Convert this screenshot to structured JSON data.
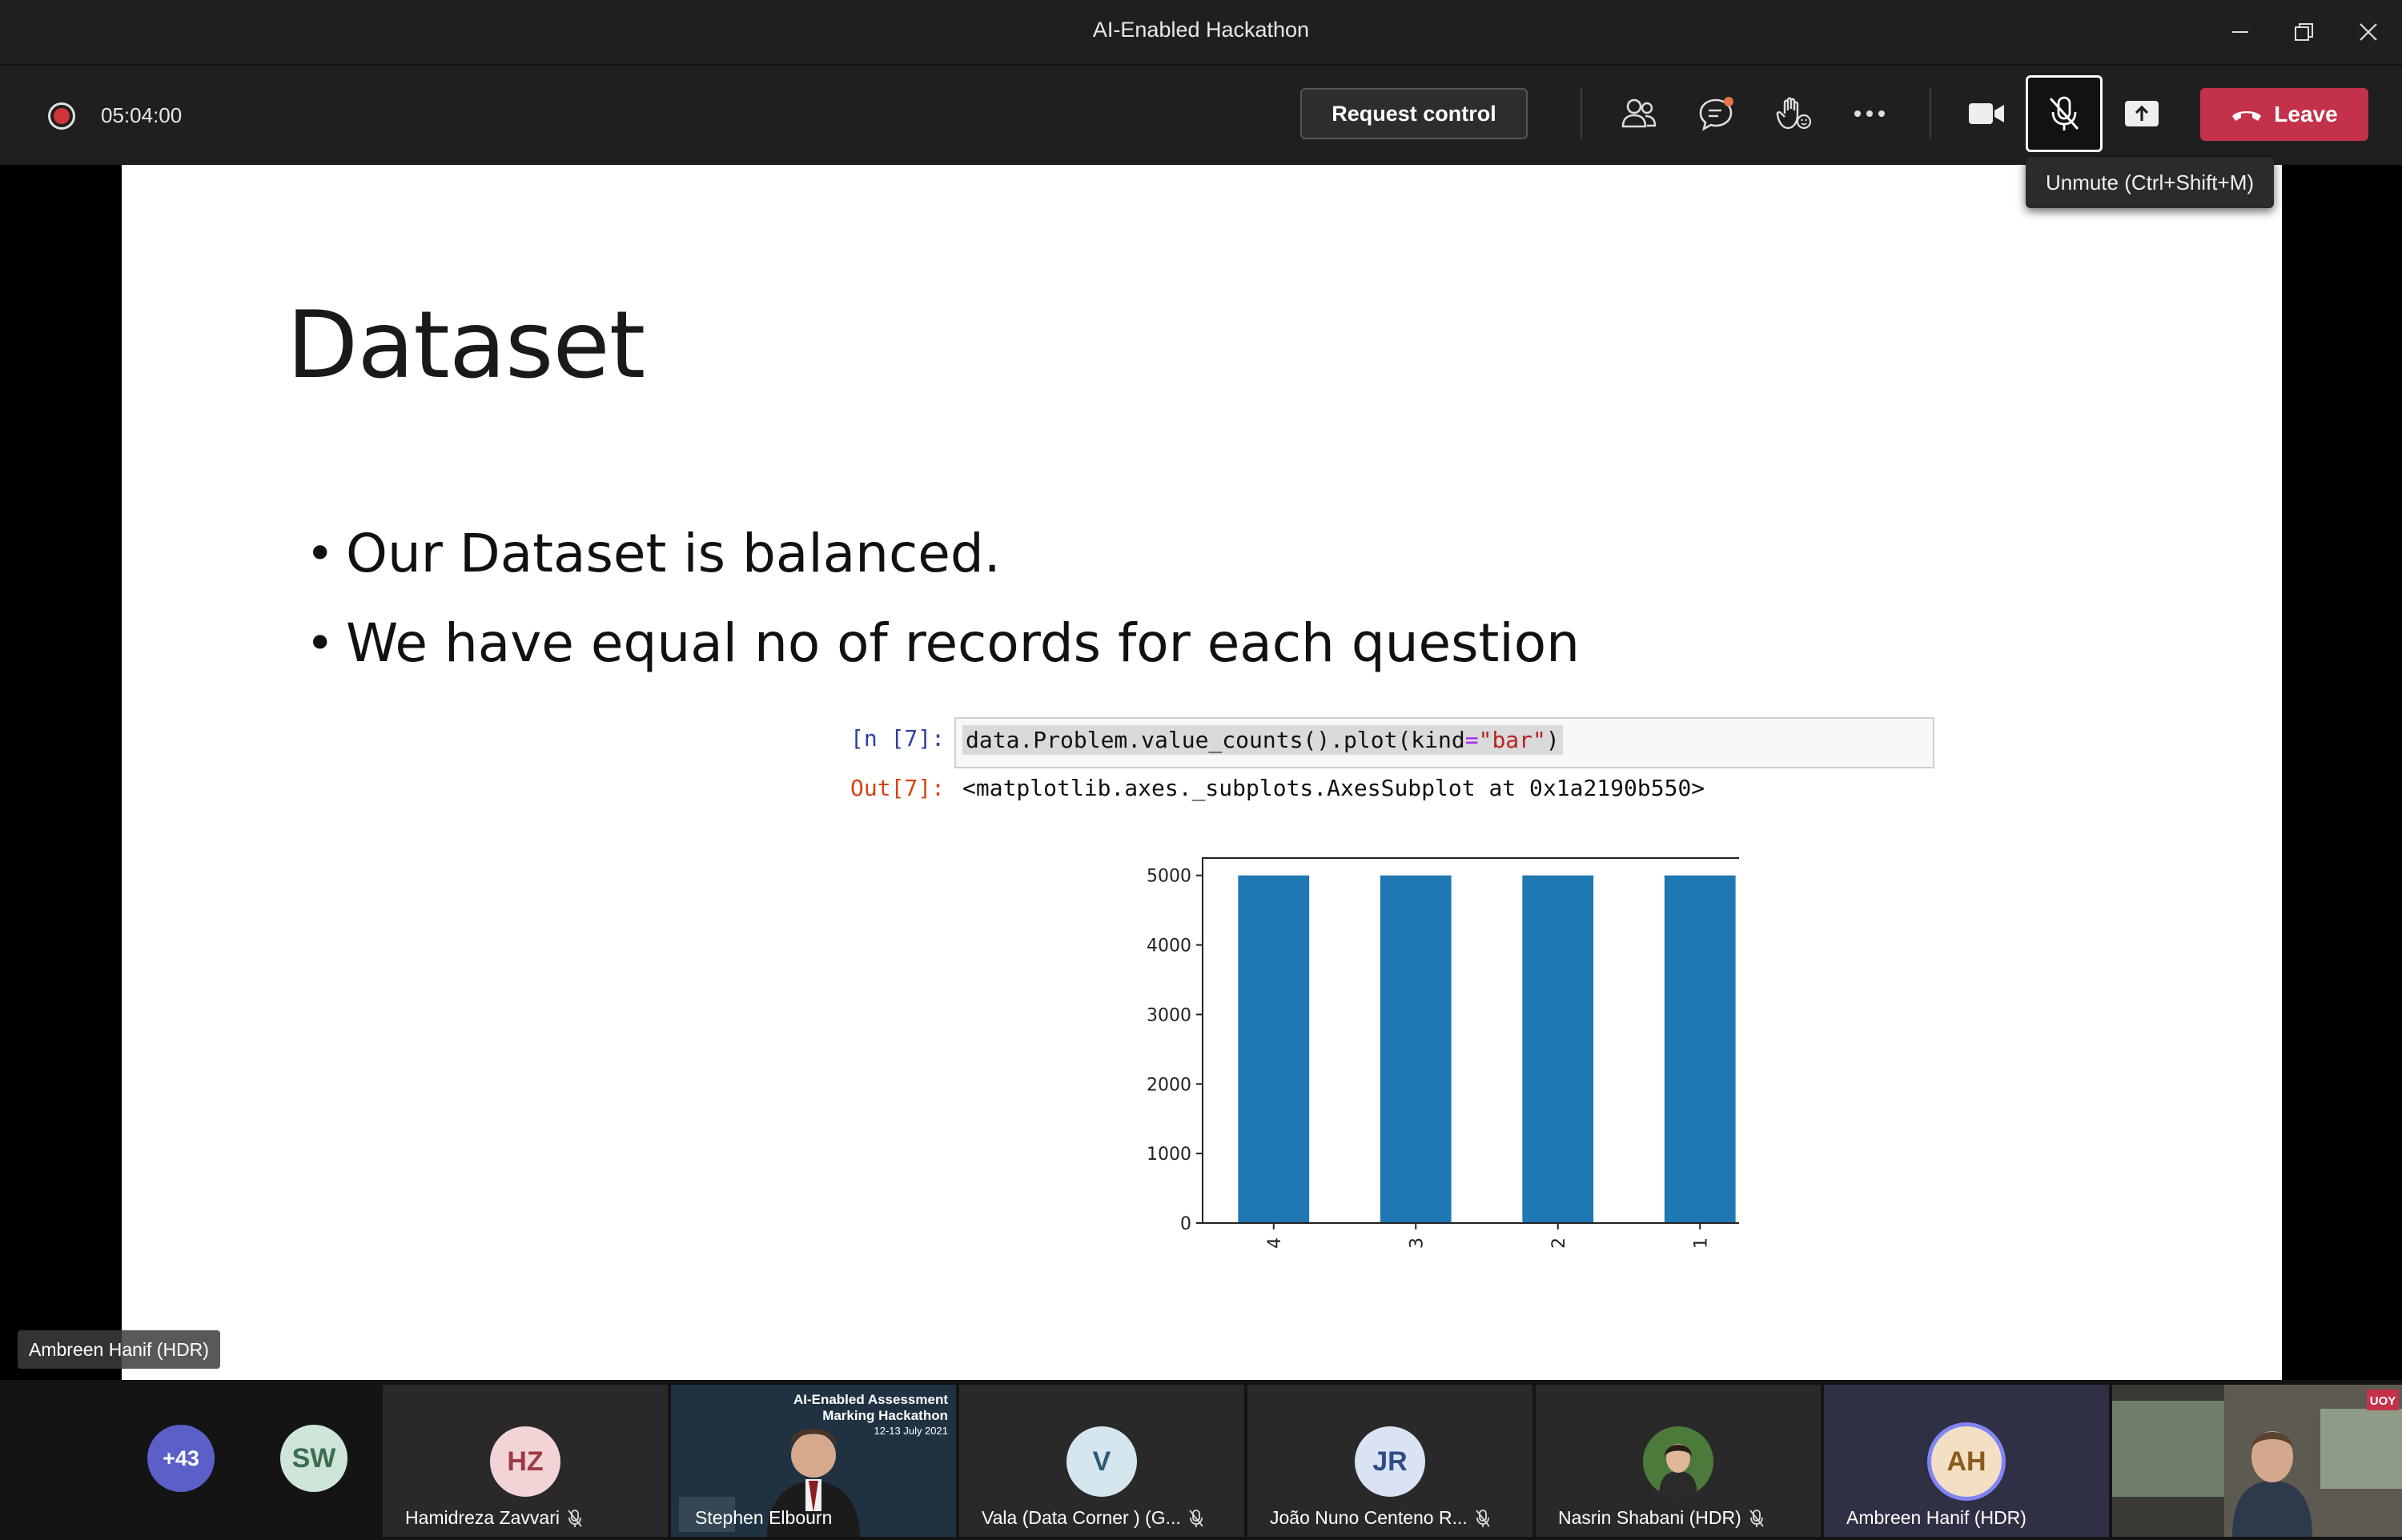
{
  "window": {
    "title": "AI-Enabled Hackathon"
  },
  "toolbar": {
    "timer": "05:04:00",
    "request_control": "Request control",
    "leave": "Leave",
    "tooltip": "Unmute (Ctrl+Shift+M)"
  },
  "slide": {
    "title": "Dataset",
    "bullets": [
      "Our Dataset is balanced.",
      "We have equal no of records for each question"
    ],
    "code": {
      "in_prompt": "[n [7]:",
      "out_prompt": "Out[7]:",
      "code_prefix": "data.Problem.value_counts().plot(kind",
      "code_op": "=",
      "code_str": "\"bar\"",
      "code_suffix": ")",
      "output": "<matplotlib.axes._subplots.AxesSubplot at 0x1a2190b550>"
    }
  },
  "chart_data": {
    "type": "bar",
    "categories": [
      "4",
      "3",
      "2",
      "1"
    ],
    "values": [
      5000,
      5000,
      5000,
      5000
    ],
    "ylim": [
      0,
      5250
    ],
    "yticks": [
      0,
      1000,
      2000,
      3000,
      4000,
      5000
    ],
    "color": "#1f77b4",
    "title": "",
    "xlabel": "",
    "ylabel": "",
    "grid": false,
    "xtick_rotation": 90
  },
  "speaker": {
    "name": "Ambreen Hanif (HDR)"
  },
  "participants": {
    "overflow": "+43",
    "sw": "SW",
    "tiles": [
      {
        "initials": "HZ",
        "name": "Hamidreza Zavvari",
        "bg": "#f2d4d7",
        "fg": "#9b3b45"
      },
      {
        "initials": "",
        "name": "Stephen Elbourn",
        "video": true,
        "poster": {
          "line1": "AI-Enabled Assessment",
          "line2": "Marking Hackathon",
          "line3": "12-13 July 2021"
        }
      },
      {
        "initials": "V",
        "name": "Vala (Data Corner ) (G...",
        "bg": "#d6e6ef",
        "fg": "#2e5a74"
      },
      {
        "initials": "JR",
        "name": "João Nuno Centeno R...",
        "bg": "#d9e3f4",
        "fg": "#2e4d86"
      },
      {
        "initials": "",
        "name": "Nasrin Shabani (HDR)",
        "photo": true
      },
      {
        "initials": "AH",
        "name": "Ambreen Hanif (HDR)",
        "bg": "#f3e0c4",
        "fg": "#8a5a1e",
        "speaking": true
      },
      {
        "initials": "",
        "name": "",
        "video": true,
        "badge": "UOY"
      }
    ]
  }
}
